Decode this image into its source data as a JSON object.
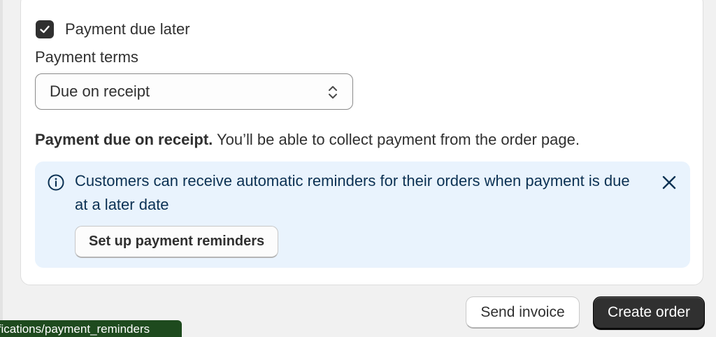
{
  "payment": {
    "due_later_label": "Payment due later",
    "due_later_checked": true,
    "terms_label": "Payment terms",
    "terms_value": "Due on receipt",
    "summary_bold": "Payment due on receipt.",
    "summary_rest": " You’ll be able to collect payment from the order page."
  },
  "banner": {
    "text": "Customers can receive automatic reminders for their orders when payment is due at a later date",
    "button_label": "Set up payment reminders"
  },
  "actions": {
    "send_invoice_label": "Send invoice",
    "create_order_label": "Create order"
  },
  "status_url": "ifications/payment_reminders",
  "icons": {
    "checkbox": "checkmark-icon",
    "select": "select-chevron-icon",
    "banner_info": "info-icon",
    "banner_close": "close-icon"
  },
  "colors": {
    "banner_bg": "#e9f3fd",
    "banner_text": "#0b3153",
    "primary_button": "#303030",
    "status_bar": "#1e4a1e"
  }
}
